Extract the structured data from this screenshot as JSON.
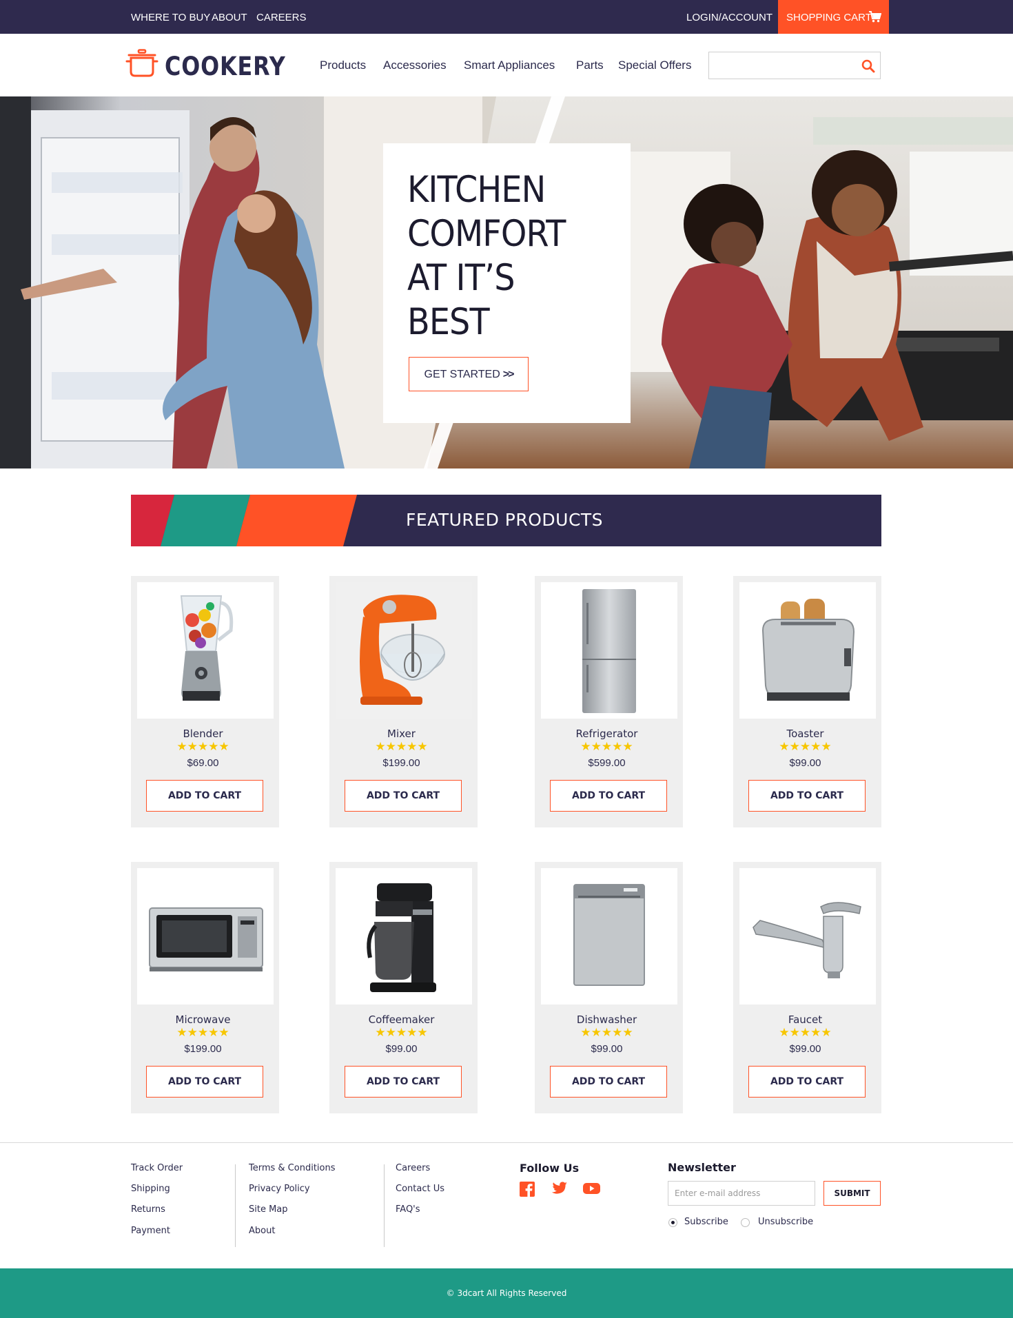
{
  "topbar": {
    "links": [
      "WHERE TO BUY",
      "ABOUT",
      "CAREERS"
    ],
    "account": "LOGIN/ACCOUNT",
    "cart": "SHOPPING CART",
    "cart_icon": "shopping-cart-icon"
  },
  "header": {
    "logo_text": "COOKERY",
    "logo_icon": "pot-icon",
    "nav": [
      "Products",
      "Accessories",
      "Smart Appliances",
      "Parts",
      "Special Offers"
    ],
    "search_value": "",
    "search_icon": "search-icon"
  },
  "hero": {
    "title": "KITCHEN\nCOMFORT\nAT IT’S\nBEST",
    "button": "GET STARTED",
    "button_icon": ">>"
  },
  "featured": {
    "title": "FEATURED PRODUCTS",
    "accent_colors": [
      "#d7263d",
      "#1e9a86",
      "#ff5226",
      "#2f2a4e"
    ]
  },
  "products": [
    {
      "name": "Blender",
      "rating": 5,
      "stars": "★★★★★",
      "price": "$69.00",
      "button": "ADD TO CART"
    },
    {
      "name": "Mixer",
      "rating": 5,
      "stars": "★★★★★",
      "price": "$199.00",
      "button": "ADD TO CART"
    },
    {
      "name": "Refrigerator",
      "rating": 5,
      "stars": "★★★★★",
      "price": "$599.00",
      "button": "ADD TO CART"
    },
    {
      "name": "Toaster",
      "rating": 5,
      "stars": "★★★★★",
      "price": "$99.00",
      "button": "ADD TO CART"
    },
    {
      "name": "Microwave",
      "rating": 5,
      "stars": "★★★★★",
      "price": "$199.00",
      "button": "ADD TO CART"
    },
    {
      "name": "Coffeemaker",
      "rating": 5,
      "stars": "★★★★★",
      "price": "$99.00",
      "button": "ADD TO CART"
    },
    {
      "name": "Dishwasher",
      "rating": 5,
      "stars": "★★★★★",
      "price": "$99.00",
      "button": "ADD TO CART"
    },
    {
      "name": "Faucet",
      "rating": 5,
      "stars": "★★★★★",
      "price": "$99.00",
      "button": "ADD TO CART"
    }
  ],
  "footer": {
    "col1": [
      "Track Order",
      "Shipping",
      "Returns",
      "Payment"
    ],
    "col2": [
      "Terms & Conditions",
      "Privacy Policy",
      "Site Map",
      "About"
    ],
    "col3": [
      "Careers",
      "Contact Us",
      "FAQ's"
    ],
    "follow_title": "Follow Us",
    "social_icons": [
      "facebook-icon",
      "twitter-icon",
      "youtube-icon"
    ],
    "newsletter_title": "Newsletter",
    "newsletter_placeholder": "Enter e-mail address",
    "newsletter_value": "",
    "submit": "SUBMIT",
    "radio_subscribe": "Subscribe",
    "radio_unsubscribe": "Unsubscribe",
    "selected": "Subscribe",
    "copyright": "© 3dcart All Rights Reserved"
  },
  "colors": {
    "navy": "#2f2a4e",
    "orange": "#ff5226",
    "teal": "#1e9a86",
    "red": "#d7263d",
    "star": "#f7c600"
  }
}
